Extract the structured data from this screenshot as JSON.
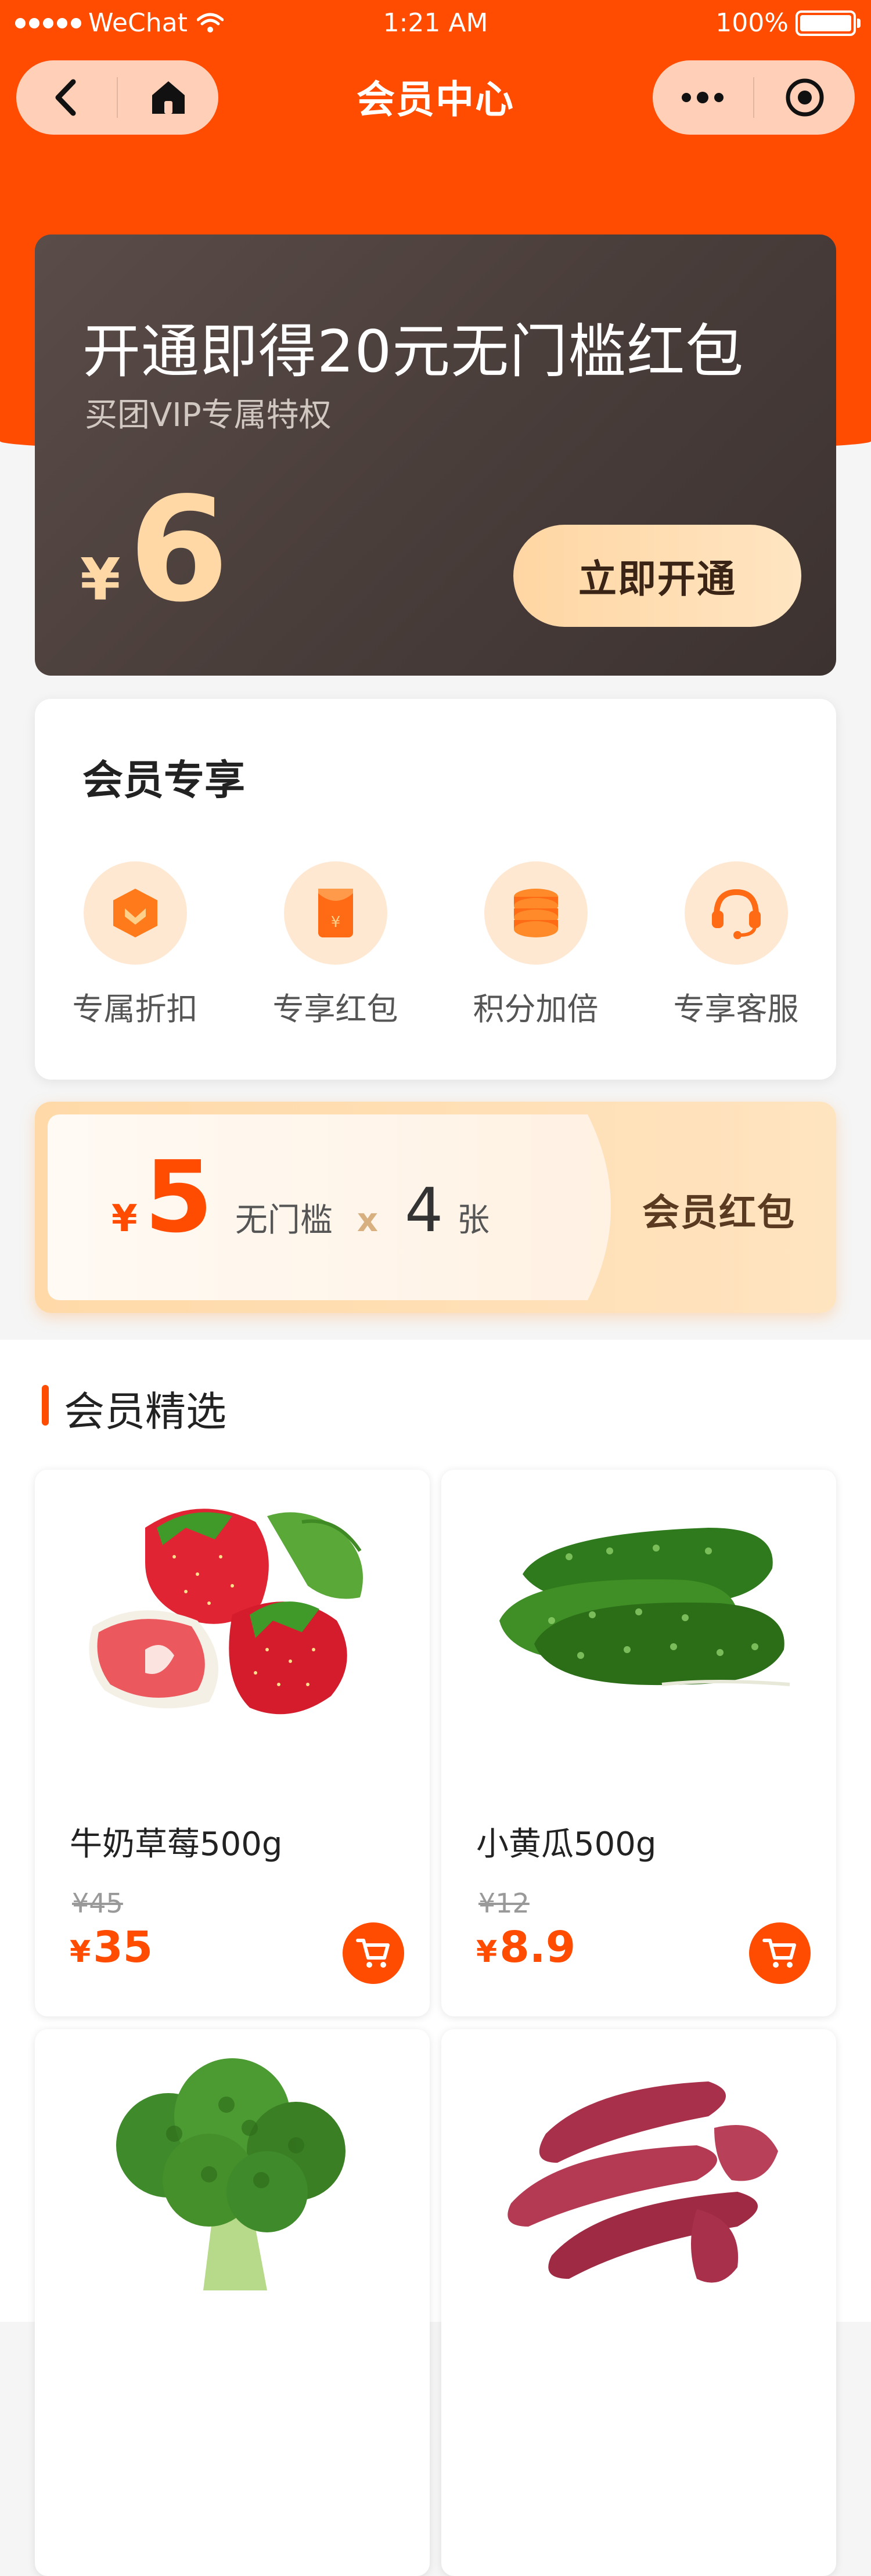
{
  "status_bar": {
    "carrier": "WeChat",
    "time": "1:21 AM",
    "battery": "100%"
  },
  "nav": {
    "title": "会员中心"
  },
  "vip_banner": {
    "title": "开通即得20元无门槛红包",
    "subtitle": "买团VIP专属特权",
    "currency": "¥",
    "price": "6",
    "button": "立即开通"
  },
  "benefits": {
    "title": "会员专享",
    "items": [
      {
        "label": "专属折扣",
        "icon": "discount-shield-icon"
      },
      {
        "label": "专享红包",
        "icon": "red-envelope-icon"
      },
      {
        "label": "积分加倍",
        "icon": "coin-stack-icon"
      },
      {
        "label": "专享客服",
        "icon": "headset-icon"
      }
    ]
  },
  "redpack": {
    "currency": "¥",
    "amount": "5",
    "desc": "无门槛",
    "times": "x",
    "count": "4",
    "unit": "张",
    "label": "会员红包"
  },
  "selection": {
    "title": "会员精选",
    "products": [
      {
        "name": "牛奶草莓500g",
        "original_price": "¥45",
        "currency": "¥",
        "price": "35",
        "image": "strawberry"
      },
      {
        "name": "小黄瓜500g",
        "original_price": "¥12",
        "currency": "¥",
        "price": "8.9",
        "image": "cucumber"
      },
      {
        "name": "",
        "image": "broccoli"
      },
      {
        "name": "",
        "image": "sweet-potato"
      }
    ]
  },
  "colors": {
    "brand_orange": "#ff4c00",
    "vip_dark": "#4a3e3b",
    "gold": "#ffd8a6"
  }
}
